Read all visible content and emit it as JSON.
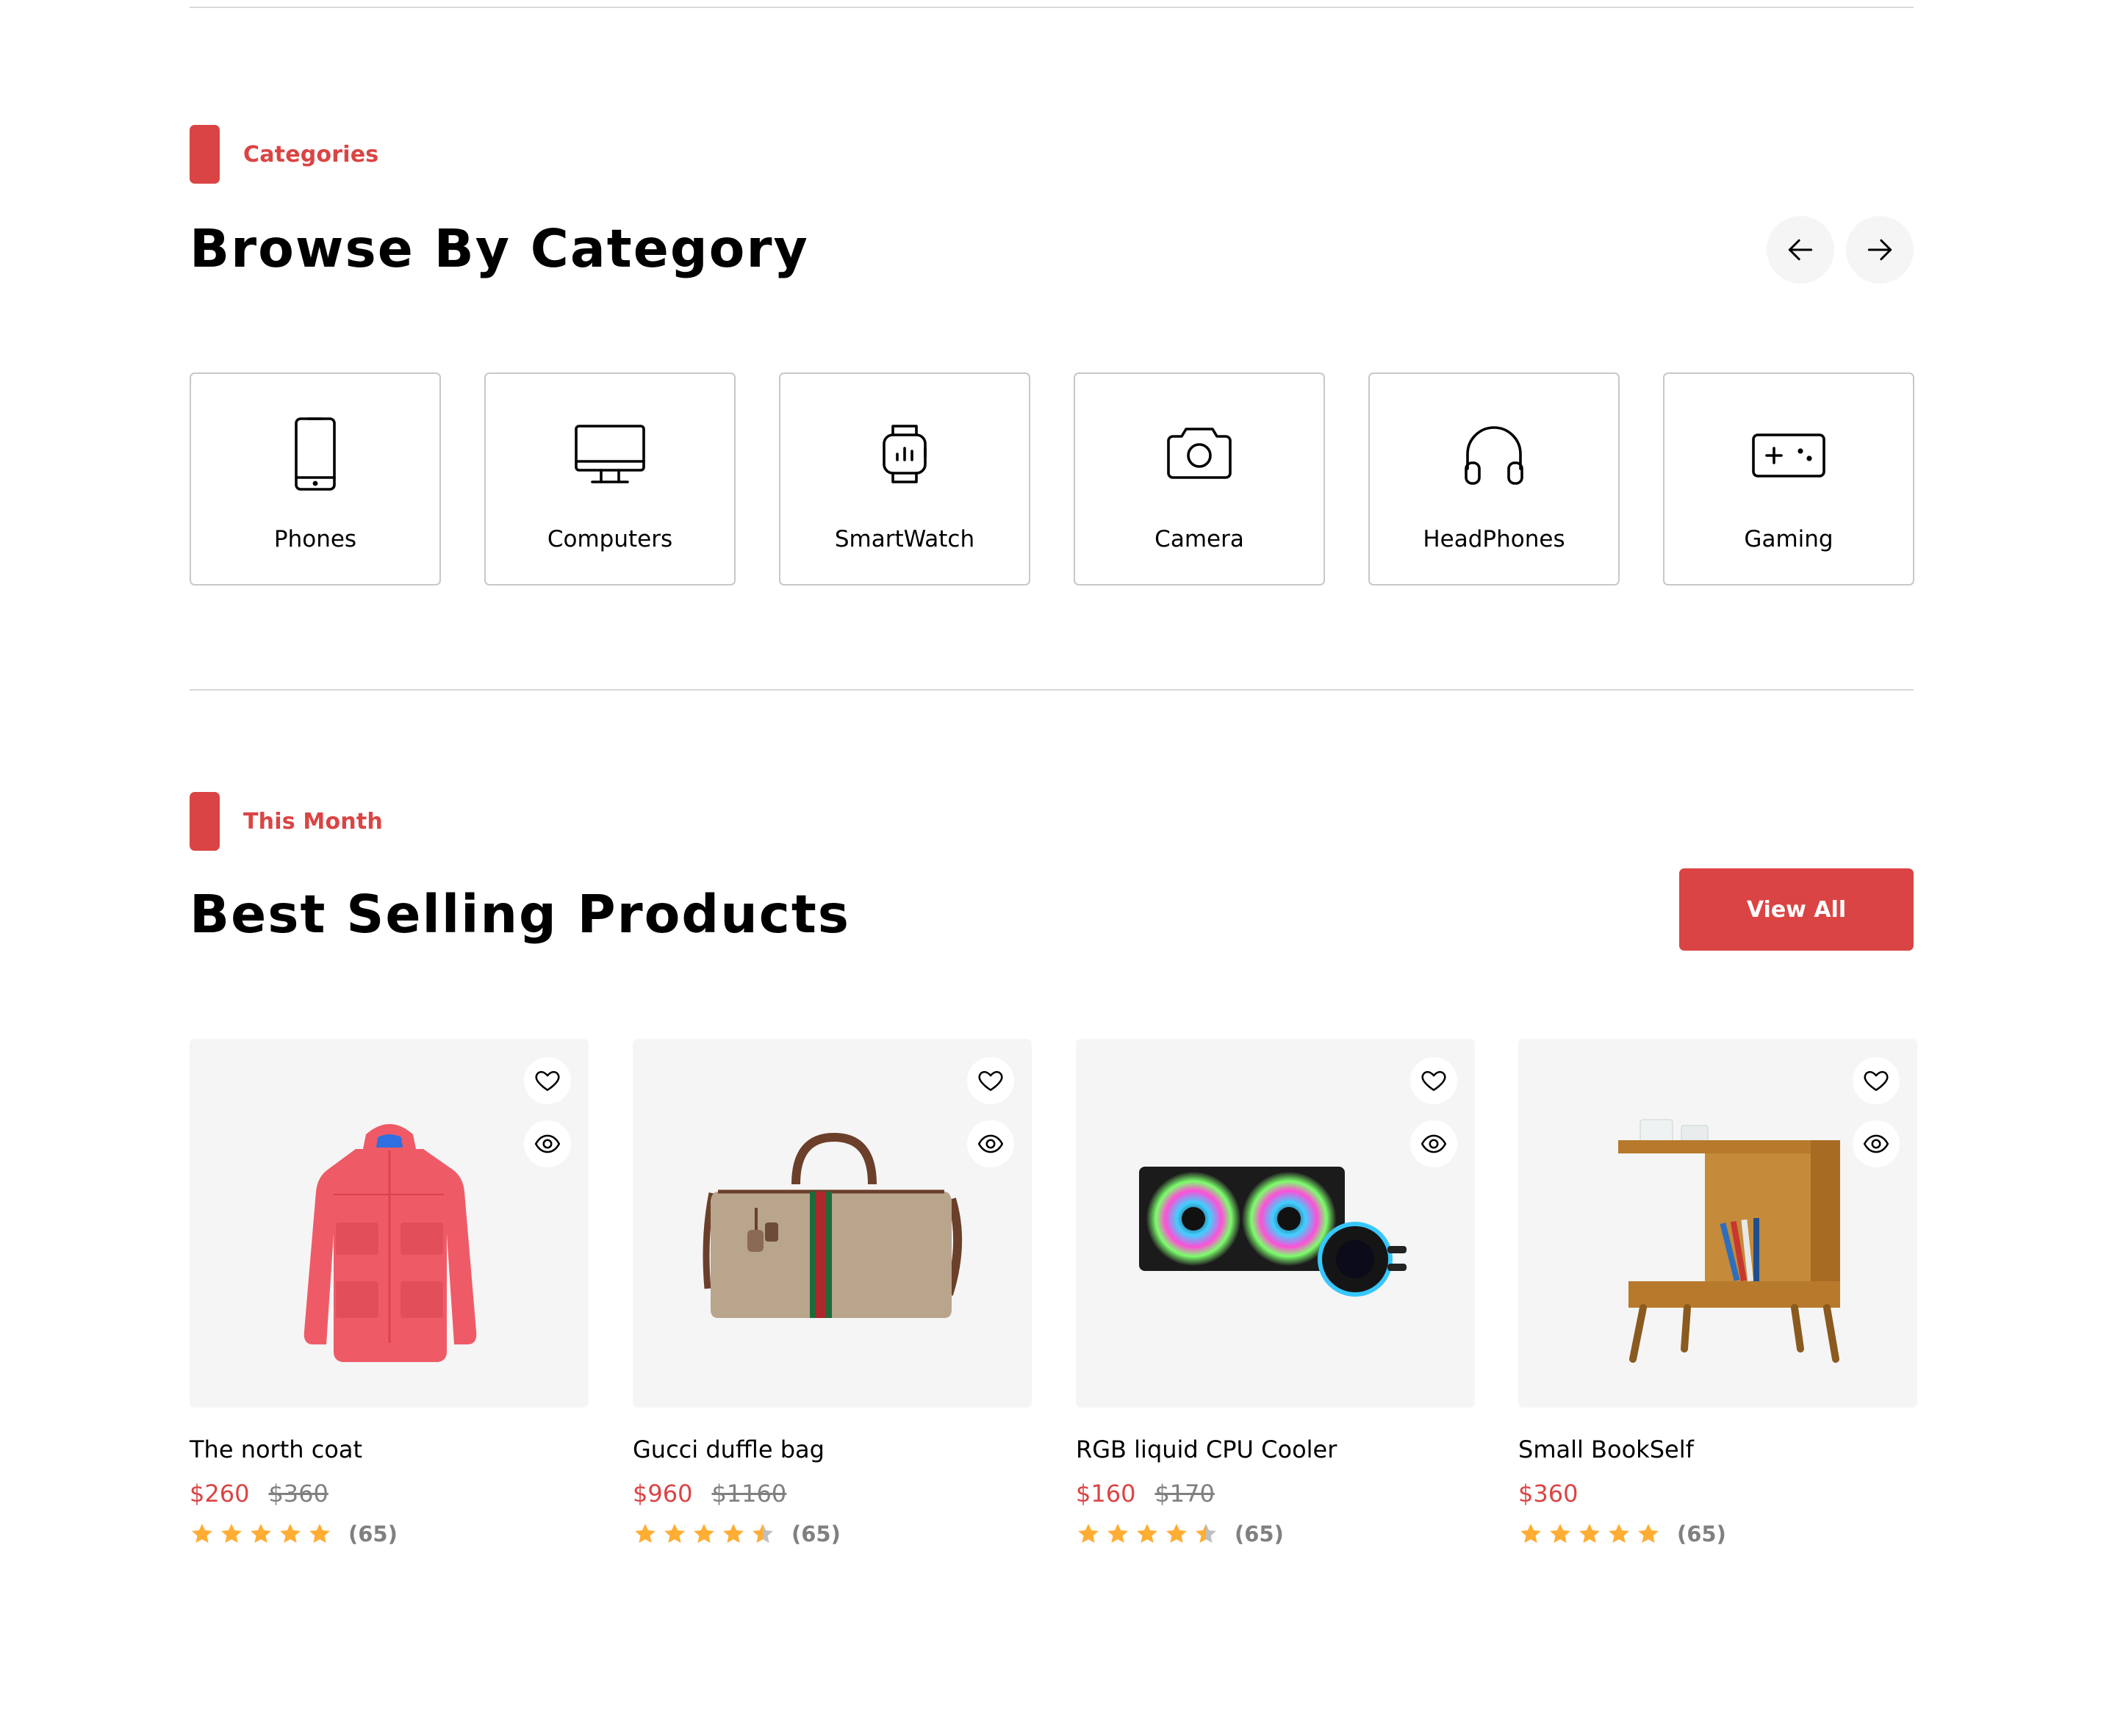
{
  "categories_section": {
    "tag": "Categories",
    "title": "Browse By Category",
    "items": [
      {
        "label": "Phones",
        "icon": "phone-icon"
      },
      {
        "label": "Computers",
        "icon": "computer-icon"
      },
      {
        "label": "SmartWatch",
        "icon": "smartwatch-icon"
      },
      {
        "label": "Camera",
        "icon": "camera-icon"
      },
      {
        "label": "HeadPhones",
        "icon": "headphones-icon"
      },
      {
        "label": "Gaming",
        "icon": "gamepad-icon"
      }
    ]
  },
  "best_selling": {
    "tag": "This Month",
    "title": "Best Selling Products",
    "view_all_label": "View All",
    "products": [
      {
        "name": "The north coat",
        "price": "$260",
        "old_price": "$360",
        "rating": 5,
        "reviews": "(65)"
      },
      {
        "name": "Gucci duffle bag",
        "price": "$960",
        "old_price": "$1160",
        "rating": 4.5,
        "reviews": "(65)"
      },
      {
        "name": "RGB liquid CPU Cooler",
        "price": "$160",
        "old_price": "$170",
        "rating": 4.5,
        "reviews": "(65)"
      },
      {
        "name": "Small BookSelf",
        "price": "$360",
        "old_price": "",
        "rating": 5,
        "reviews": "(65)"
      }
    ]
  },
  "colors": {
    "accent": "#DB4444",
    "star": "#FFAD33",
    "star_empty": "#BFBFBF",
    "card_bg": "#F5F5F5"
  }
}
